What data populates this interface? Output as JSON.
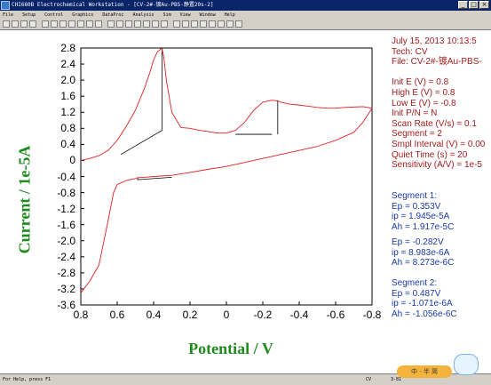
{
  "window": {
    "title": "CHI660B Electrochemical Workstation - [CV-2#-镀Au-PBS-静置20s-2]",
    "buttons": [
      "_",
      "□",
      "×"
    ]
  },
  "menu": [
    "File",
    "Setup",
    "Control",
    "Graphics",
    "DataProc",
    "Analysis",
    "Sim",
    "View",
    "Window",
    "Help"
  ],
  "chart_data": {
    "type": "line",
    "xlabel": "Potential / V",
    "ylabel": "Current / 1e-5A",
    "x_ticks": [
      "0.8",
      "0.6",
      "0.4",
      "0.2",
      "0",
      "-0.2",
      "-0.4",
      "-0.6",
      "-0.8"
    ],
    "y_ticks": [
      "2.8",
      "2.4",
      "2.0",
      "1.6",
      "1.2",
      "0.8",
      "0.4",
      "0",
      "-0.4",
      "-0.8",
      "-1.2",
      "-1.6",
      "-2.0",
      "-2.4",
      "-2.8",
      "-3.2",
      "-3.6"
    ],
    "xlim": [
      0.8,
      -0.8
    ],
    "ylim": [
      -3.6,
      2.8
    ],
    "series": [
      {
        "color": "#e02020",
        "x": [
          0.8,
          0.75,
          0.7,
          0.65,
          0.6,
          0.55,
          0.5,
          0.45,
          0.42,
          0.4,
          0.38,
          0.36,
          0.353,
          0.345,
          0.33,
          0.3,
          0.25,
          0.2,
          0.15,
          0.1,
          0.05,
          0,
          -0.05,
          -0.1,
          -0.15,
          -0.2,
          -0.25,
          -0.282,
          -0.3,
          -0.35,
          -0.4,
          -0.45,
          -0.5,
          -0.55,
          -0.6,
          -0.65,
          -0.7,
          -0.75,
          -0.8,
          -0.75,
          -0.7,
          -0.6,
          -0.5,
          -0.4,
          -0.3,
          -0.2,
          -0.1,
          0,
          0.1,
          0.2,
          0.3,
          0.4,
          0.45,
          0.487,
          0.5,
          0.55,
          0.6,
          0.62,
          0.65,
          0.7,
          0.75,
          0.8
        ],
        "y": [
          0.0,
          0.05,
          0.12,
          0.25,
          0.5,
          0.85,
          1.25,
          1.8,
          2.2,
          2.5,
          2.7,
          2.78,
          2.78,
          2.6,
          2.0,
          1.2,
          0.82,
          0.8,
          0.75,
          0.72,
          0.68,
          0.68,
          0.75,
          0.95,
          1.25,
          1.45,
          1.5,
          1.48,
          1.45,
          1.4,
          1.38,
          1.35,
          1.32,
          1.3,
          1.3,
          1.32,
          1.33,
          1.34,
          1.3,
          0.95,
          0.7,
          0.5,
          0.35,
          0.25,
          0.15,
          0.05,
          -0.05,
          -0.15,
          -0.22,
          -0.3,
          -0.37,
          -0.4,
          -0.42,
          -0.43,
          -0.45,
          -0.5,
          -0.6,
          -0.8,
          -1.5,
          -2.6,
          -3.0,
          -3.3
        ]
      }
    ],
    "baselines": [
      {
        "x": [
          0.58,
          0.353
        ],
        "y": [
          0.15,
          0.75
        ]
      },
      {
        "x": [
          0.353,
          0.353
        ],
        "y": [
          0.75,
          2.78
        ]
      },
      {
        "x": [
          -0.25,
          -0.05
        ],
        "y": [
          0.65,
          0.65
        ]
      },
      {
        "x": [
          -0.282,
          -0.282
        ],
        "y": [
          0.65,
          1.5
        ]
      },
      {
        "x": [
          0.49,
          0.3
        ],
        "y": [
          -0.48,
          -0.42
        ]
      },
      {
        "x": [
          0.487,
          0.487
        ],
        "y": [
          -0.48,
          -0.43
        ]
      }
    ]
  },
  "info": [
    "July 15, 2013   10:13:5",
    "Tech: CV",
    "File: CV-2#-镀Au-PBS-",
    "",
    "Init E (V) = 0.8",
    "High E (V) = 0.8",
    "Low E (V) = -0.8",
    "Init P/N = N",
    "Scan Rate (V/s) = 0.1",
    "Segment = 2",
    "Smpl Interval (V) = 0.00",
    "Quiet Time (s) = 20",
    "Sensitivity (A/V) = 1e-5"
  ],
  "segments": [
    [
      "Segment 1:",
      "Ep = 0.353V",
      "ip = 1.945e-5A",
      "Ah = 1.917e-5C"
    ],
    [
      "Ep = -0.282V",
      "ip = 8.983e-6A",
      "Ah = 8.273e-6C"
    ],
    [
      "Segment 2:",
      "Ep = 0.487V",
      "ip = -1.071e-6A",
      "Ah = -1.056e-6C"
    ]
  ],
  "status": {
    "left": "For Help, press F1",
    "mid": "CV",
    "right": "3-81"
  },
  "ime": {
    "label": "中 · 半 简"
  }
}
